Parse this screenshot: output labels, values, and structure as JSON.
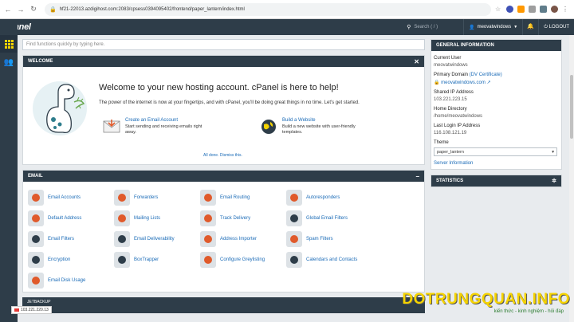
{
  "browser": {
    "url": "hf21-22013.azdigihost.com:2083/cpsess0394095402/frontend/paper_lantern/index.html"
  },
  "topbar": {
    "logo": "cPanel",
    "search_placeholder": "Search ( / )",
    "username": "meovatwindows",
    "logout_label": "LOGOUT"
  },
  "main": {
    "search_placeholder": "Find functions quickly by typing here.",
    "welcome": {
      "header": "WELCOME",
      "title": "Welcome to your new hosting account. cPanel is here to help!",
      "subtitle": "The power of the internet is now at your fingertips, and with cPanel, you'll be doing great things in no time. Let's get started.",
      "link1_title": "Create an Email Account",
      "link1_desc": "Start sending and receiving emails right away.",
      "link2_title": "Build a Website",
      "link2_desc": "Build a new website with user-friendly templates.",
      "dismiss": "All done. Dismiss this."
    },
    "email": {
      "header": "EMAIL",
      "items": [
        {
          "label": "Email Accounts",
          "icon": "email-accounts-icon",
          "color": "#e05a2b"
        },
        {
          "label": "Forwarders",
          "icon": "forwarders-icon",
          "color": "#e05a2b"
        },
        {
          "label": "Email Routing",
          "icon": "email-routing-icon",
          "color": "#e05a2b"
        },
        {
          "label": "Autoresponders",
          "icon": "autoresponders-icon",
          "color": "#e05a2b"
        },
        {
          "label": "Default Address",
          "icon": "default-address-icon",
          "color": "#e05a2b"
        },
        {
          "label": "Mailing Lists",
          "icon": "mailing-lists-icon",
          "color": "#e05a2b"
        },
        {
          "label": "Track Delivery",
          "icon": "track-delivery-icon",
          "color": "#e05a2b"
        },
        {
          "label": "Global Email Filters",
          "icon": "global-email-filters-icon",
          "color": "#2e3d49"
        },
        {
          "label": "Email Filters",
          "icon": "email-filters-icon",
          "color": "#2e3d49"
        },
        {
          "label": "Email Deliverability",
          "icon": "email-deliverability-icon",
          "color": "#2e3d49"
        },
        {
          "label": "Address Importer",
          "icon": "address-importer-icon",
          "color": "#e05a2b"
        },
        {
          "label": "Spam Filters",
          "icon": "spam-filters-icon",
          "color": "#e05a2b"
        },
        {
          "label": "Encryption",
          "icon": "encryption-icon",
          "color": "#2e3d49"
        },
        {
          "label": "BoxTrapper",
          "icon": "boxtrapper-icon",
          "color": "#2e3d49"
        },
        {
          "label": "Configure Greylisting",
          "icon": "greylisting-icon",
          "color": "#e05a2b"
        },
        {
          "label": "Calendars and Contacts",
          "icon": "calendars-icon",
          "color": "#2e3d49"
        },
        {
          "label": "Email Disk Usage",
          "icon": "email-disk-usage-icon",
          "color": "#e05a2b"
        }
      ]
    },
    "next_section_header": "JETBACKUP"
  },
  "general_info": {
    "header": "GENERAL INFORMATION",
    "current_user_label": "Current User",
    "current_user": "meovatwindows",
    "primary_domain_label": "Primary Domain",
    "dv_label": "(DV Certificate)",
    "primary_domain": "meovatwindows.com",
    "shared_ip_label": "Shared IP Address",
    "shared_ip": "103.221.223.15",
    "home_dir_label": "Home Directory",
    "home_dir": "/home/meovatwindows",
    "last_login_label": "Last Login IP Address",
    "last_login": "116.108.121.19",
    "theme_label": "Theme",
    "theme_value": "paper_lantern",
    "server_info": "Server Information"
  },
  "statistics": {
    "header": "STATISTICS"
  },
  "footer": {
    "ip_tag": "103.221.220.13",
    "watermark": "DOTRUNGQUAN.INFO",
    "watermark_sub": "kiến thức - kinh nghiệm - hỏi đáp"
  }
}
